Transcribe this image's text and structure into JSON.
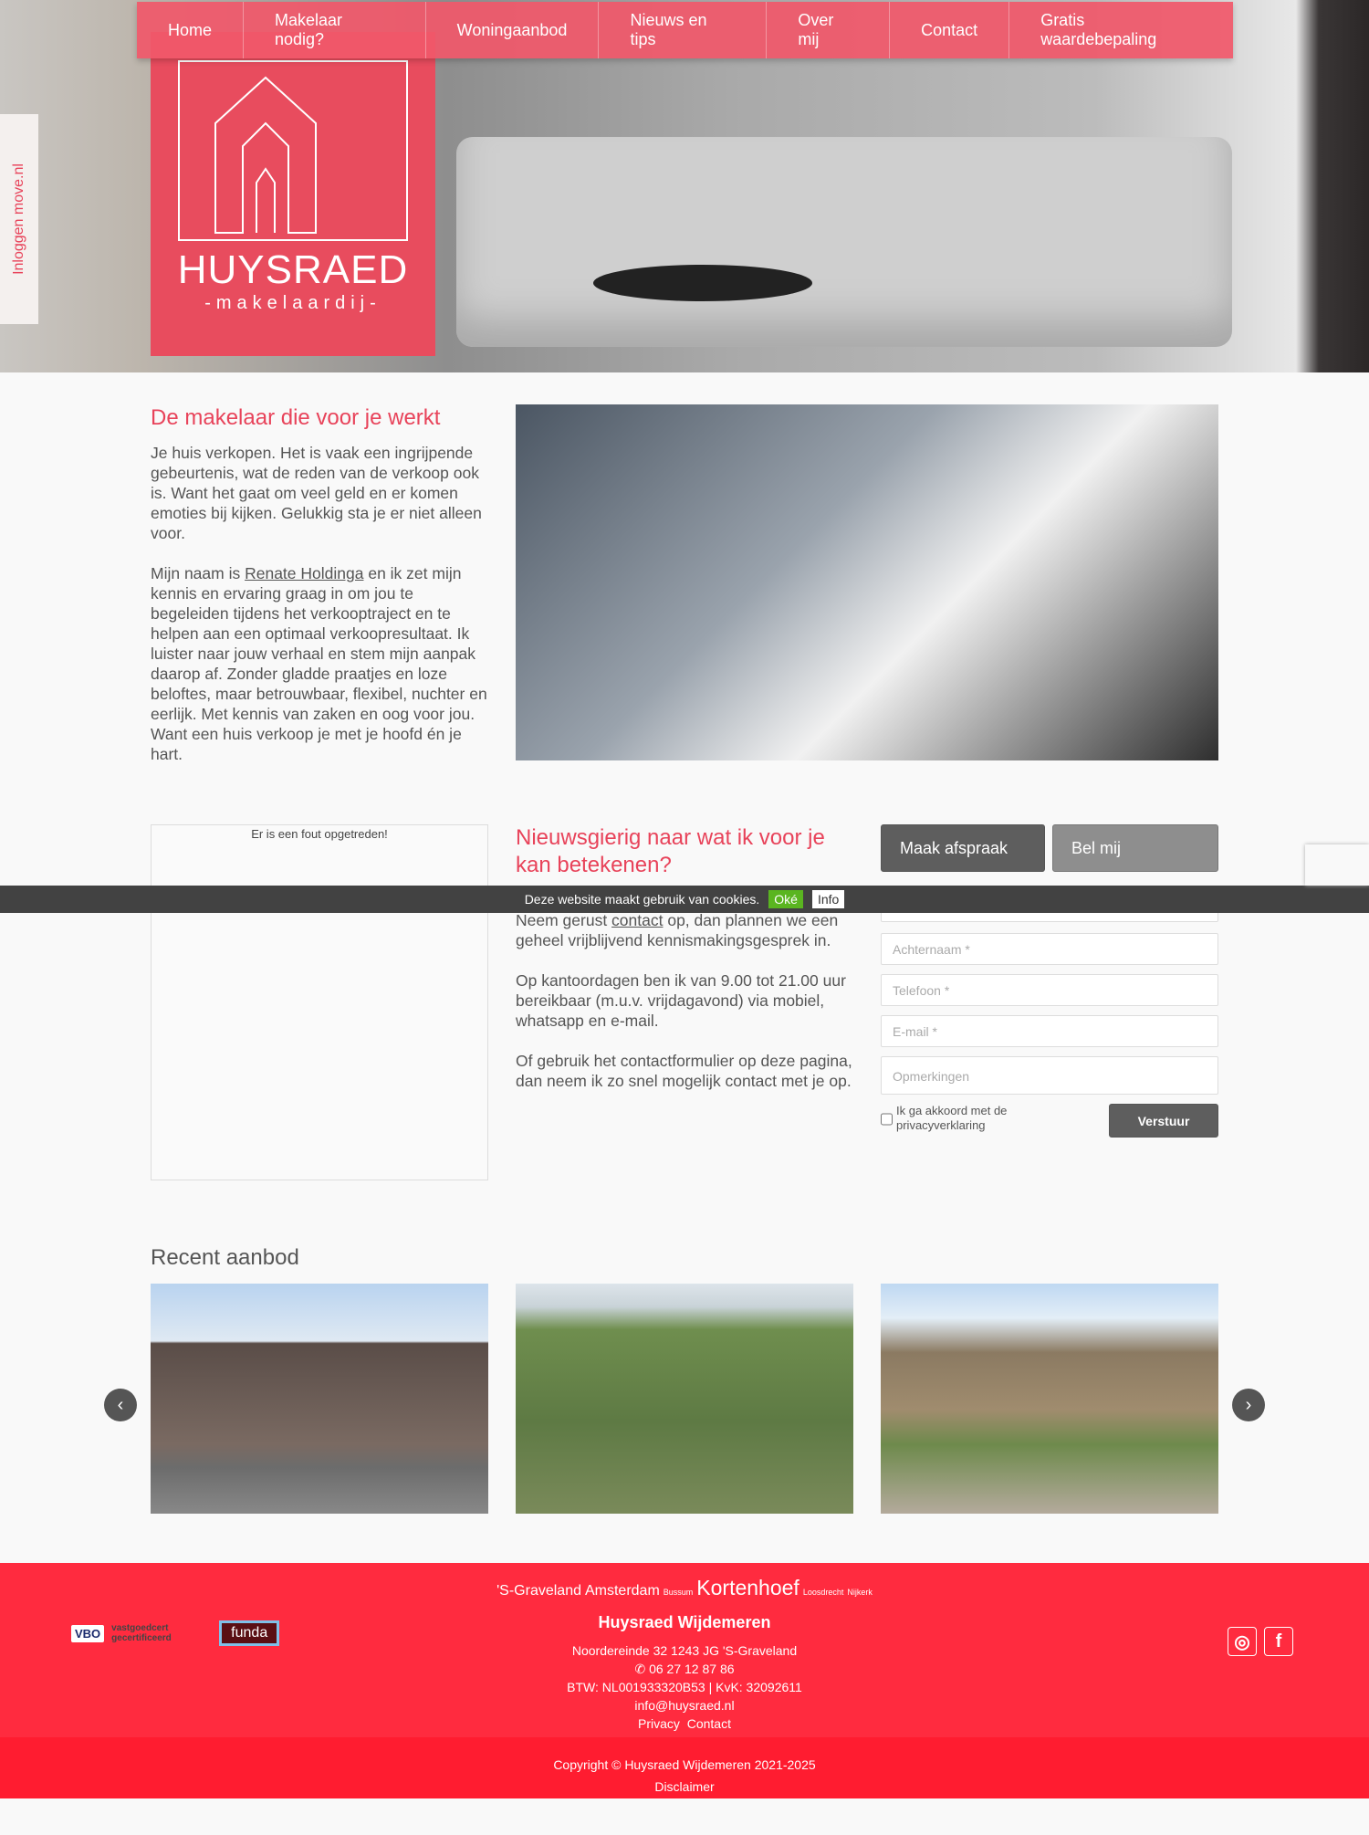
{
  "nav": [
    "Home",
    "Makelaar nodig?",
    "Woningaanbod",
    "Nieuws en tips",
    "Over mij",
    "Contact",
    "Gratis waardebepaling"
  ],
  "login_tab": "Inloggen move.nl",
  "logo": {
    "name": "HUYSRAED",
    "sub": "-makelaardij-"
  },
  "intro": {
    "title": "De makelaar die voor je werkt",
    "p1": "Je huis verkopen. Het is vaak een ingrijpende gebeurtenis, wat de reden van de verkoop ook is. Want het gaat om veel geld en er komen emoties bij kijken. Gelukkig sta je er niet alleen voor.",
    "p2_a": "Mijn naam is ",
    "p2_link": "Renate Holdinga",
    "p2_b": " en ik zet mijn kennis en ervaring graag in om jou te begeleiden tijdens het verkooptraject en te helpen aan een optimaal verkoopresultaat. Ik luister naar jouw verhaal en stem mijn aanpak daarop af. Zonder gladde praatjes en loze beloftes, maar betrouwbaar, flexibel, nuchter en eerlijk. Met kennis van zaken en oog voor jou. Want een huis verkoop je met je hoofd én je hart."
  },
  "map_error": "Er is een fout opgetreden!",
  "contact": {
    "title": "Nieuwsgierig naar wat ik voor je kan betekenen?",
    "p1_a": "Neem gerust ",
    "p1_link": "contact",
    "p1_b": " op, dan plannen we een geheel vrijblijvend kennismakingsgesprek in.",
    "p2": "Op kantoordagen ben ik van 9.00 tot 21.00 uur bereikbaar (m.u.v. vrijdagavond) via mobiel, whatsapp en e-mail.",
    "p3": "Of gebruik het contactformulier op deze pagina, dan neem ik zo snel mogelijk contact met je op."
  },
  "form": {
    "btn_afspraak": "Maak afspraak",
    "btn_bel": "Bel mij",
    "achternaam": "Achternaam *",
    "telefoon": "Telefoon *",
    "email": "E-mail *",
    "opmerkingen": "Opmerkingen",
    "consent": "Ik ga akkoord met de privacyverklaring",
    "submit": "Verstuur"
  },
  "cookie": {
    "text": "Deze website maakt gebruik van cookies.",
    "ok": "Oké",
    "info": "Info"
  },
  "recent": {
    "title": "Recent aanbod"
  },
  "footer": {
    "places": [
      "'S-Graveland",
      "Amsterdam",
      "Bussum",
      "Kortenhoef",
      "Loosdrecht",
      "Nijkerk"
    ],
    "company": "Huysraed Wijdemeren",
    "address": "Noordereinde 32  1243 JG 'S-Graveland",
    "phone": "06 27 12 87 86",
    "btw": "BTW: NL001933320B53 | KvK: 32092611",
    "email": "info@huysraed.nl",
    "privacy": "Privacy",
    "contact": "Contact",
    "logos": [
      "VBO",
      "vastgoedcert gecertificeerd",
      "funda"
    ],
    "copyright": "Copyright © Huysraed Wijdemeren 2021-2025",
    "disclaimer": "Disclaimer"
  },
  "colors": {
    "accent": "#e8435a",
    "footer": "#ff2b3f",
    "footer_bottom": "#ff1c30"
  }
}
